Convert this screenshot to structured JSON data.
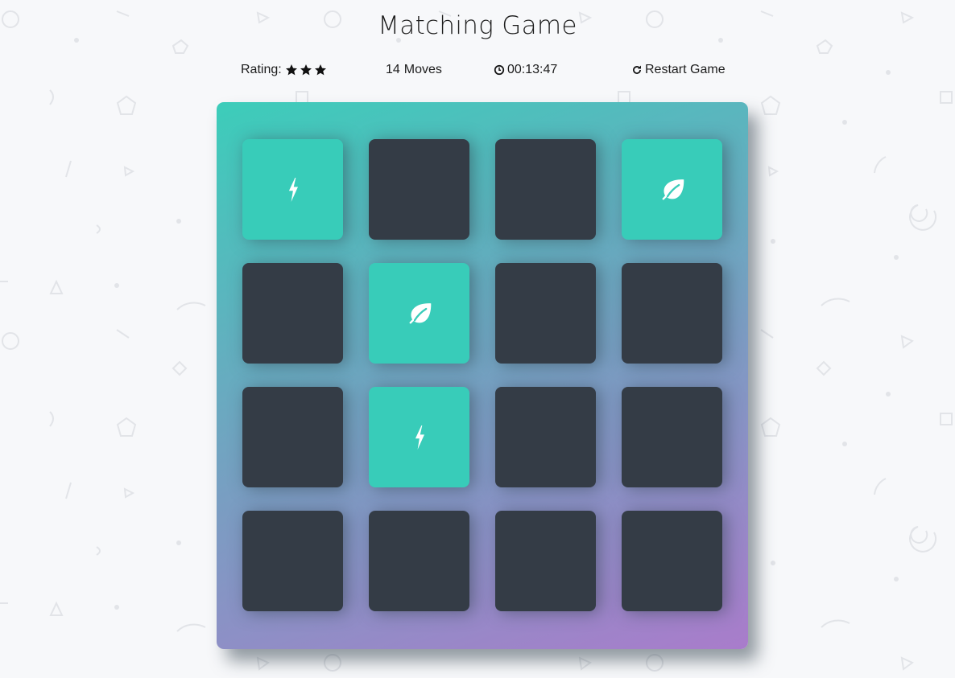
{
  "game": {
    "title": "Matching Game"
  },
  "score": {
    "rating_label": "Rating:",
    "stars": 3,
    "moves_count": "14",
    "moves_label": "Moves",
    "timer": "00:13:47",
    "restart_label": "Restart Game"
  },
  "colors": {
    "card_back": "#343c46",
    "card_open": "#38ccb9",
    "deck_gradient": [
      "#3ccdba",
      "#7a9dc2",
      "#a97ccb"
    ]
  },
  "cards": [
    {
      "state": "open",
      "icon": "bolt-icon"
    },
    {
      "state": "closed"
    },
    {
      "state": "closed"
    },
    {
      "state": "open",
      "icon": "leaf-icon"
    },
    {
      "state": "closed"
    },
    {
      "state": "open",
      "icon": "leaf-icon"
    },
    {
      "state": "closed"
    },
    {
      "state": "closed"
    },
    {
      "state": "closed"
    },
    {
      "state": "open",
      "icon": "bolt-icon"
    },
    {
      "state": "closed"
    },
    {
      "state": "closed"
    },
    {
      "state": "closed"
    },
    {
      "state": "closed"
    },
    {
      "state": "closed"
    },
    {
      "state": "closed"
    }
  ]
}
